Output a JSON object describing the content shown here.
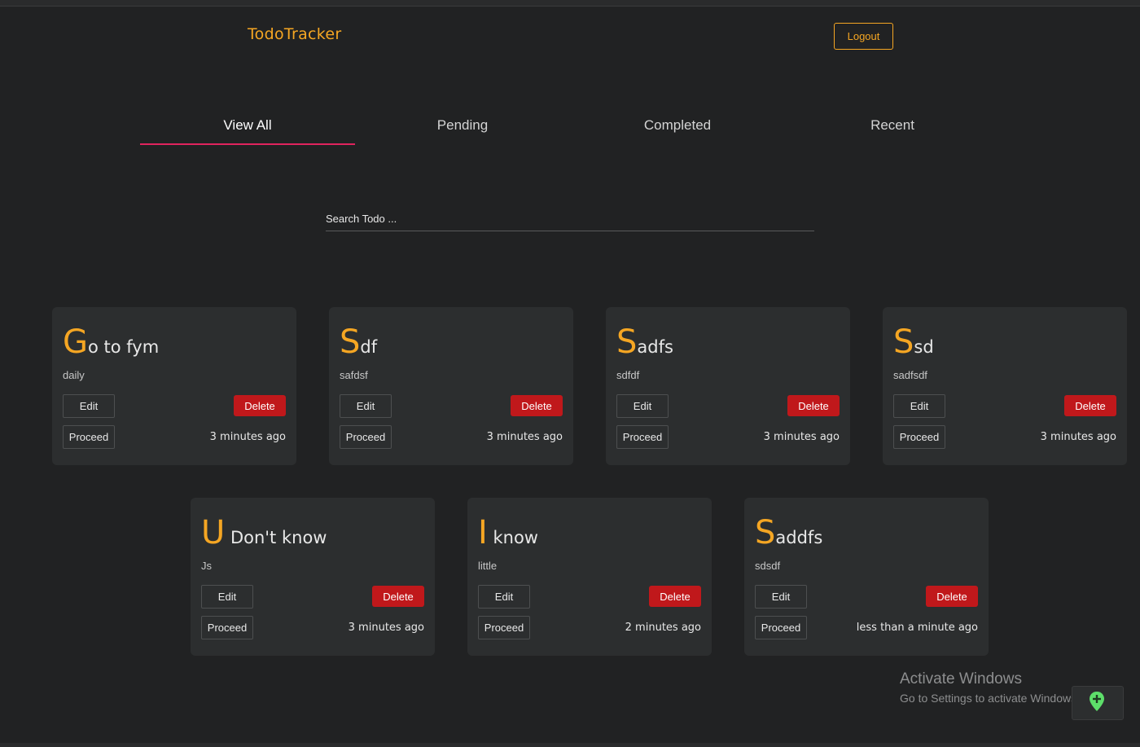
{
  "header": {
    "brand": "TodoTracker",
    "logout_label": "Logout"
  },
  "tabs": [
    {
      "label": "View All",
      "active": true
    },
    {
      "label": "Pending",
      "active": false
    },
    {
      "label": "Completed",
      "active": false
    },
    {
      "label": "Recent",
      "active": false
    }
  ],
  "search": {
    "placeholder": "Search Todo ...",
    "value": ""
  },
  "cards": [
    {
      "initial": "G",
      "rest": "o to fym",
      "description": "daily",
      "edit_label": "Edit",
      "delete_label": "Delete",
      "proceed_label": "Proceed",
      "time": "3 minutes ago"
    },
    {
      "initial": "S",
      "rest": "df",
      "description": "safdsf",
      "edit_label": "Edit",
      "delete_label": "Delete",
      "proceed_label": "Proceed",
      "time": "3 minutes ago"
    },
    {
      "initial": "S",
      "rest": "adfs",
      "description": "sdfdf",
      "edit_label": "Edit",
      "delete_label": "Delete",
      "proceed_label": "Proceed",
      "time": "3 minutes ago"
    },
    {
      "initial": "S",
      "rest": "sd",
      "description": "sadfsdf",
      "edit_label": "Edit",
      "delete_label": "Delete",
      "proceed_label": "Proceed",
      "time": "3 minutes ago"
    },
    {
      "initial": "U",
      "rest": " Don't know",
      "description": "Js",
      "edit_label": "Edit",
      "delete_label": "Delete",
      "proceed_label": "Proceed",
      "time": "3 minutes ago"
    },
    {
      "initial": "I",
      "rest": " know",
      "description": "little",
      "edit_label": "Edit",
      "delete_label": "Delete",
      "proceed_label": "Proceed",
      "time": "2 minutes ago"
    },
    {
      "initial": "S",
      "rest": "addfs",
      "description": "sdsdf",
      "edit_label": "Edit",
      "delete_label": "Delete",
      "proceed_label": "Proceed",
      "time": "less than a minute ago"
    }
  ],
  "watermark": {
    "line1": "Activate Windows",
    "line2": "Go to Settings to activate Windows."
  },
  "fab": {
    "icon": "map-pin-plus-icon"
  },
  "colors": {
    "background": "#212223",
    "card": "#2c2e2f",
    "accent": "#f5a623",
    "tab_underline": "#e0245e",
    "delete": "#c0181b",
    "fab_icon": "#5dde6a"
  }
}
